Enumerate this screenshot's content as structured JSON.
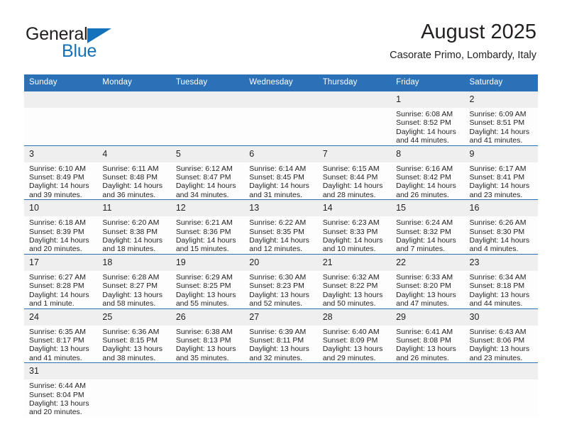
{
  "brand": {
    "name_part1": "General",
    "name_part2": "Blue",
    "triangle_icon": "triangle-icon",
    "accent_color": "#1471bb"
  },
  "header": {
    "title": "August 2025",
    "subtitle": "Casorate Primo, Lombardy, Italy"
  },
  "colors": {
    "header_blue": "#2b71b8",
    "daynum_band": "#efefef",
    "row_divider": "#2b71b8",
    "text": "#231f20"
  },
  "calendar": {
    "weekday_headers": [
      "Sunday",
      "Monday",
      "Tuesday",
      "Wednesday",
      "Thursday",
      "Friday",
      "Saturday"
    ],
    "weeks": [
      [
        {
          "day": "",
          "info": ""
        },
        {
          "day": "",
          "info": ""
        },
        {
          "day": "",
          "info": ""
        },
        {
          "day": "",
          "info": ""
        },
        {
          "day": "",
          "info": ""
        },
        {
          "day": "1",
          "info": "Sunrise: 6:08 AM\nSunset: 8:52 PM\nDaylight: 14 hours\nand 44 minutes."
        },
        {
          "day": "2",
          "info": "Sunrise: 6:09 AM\nSunset: 8:51 PM\nDaylight: 14 hours\nand 41 minutes."
        }
      ],
      [
        {
          "day": "3",
          "info": "Sunrise: 6:10 AM\nSunset: 8:49 PM\nDaylight: 14 hours\nand 39 minutes."
        },
        {
          "day": "4",
          "info": "Sunrise: 6:11 AM\nSunset: 8:48 PM\nDaylight: 14 hours\nand 36 minutes."
        },
        {
          "day": "5",
          "info": "Sunrise: 6:12 AM\nSunset: 8:47 PM\nDaylight: 14 hours\nand 34 minutes."
        },
        {
          "day": "6",
          "info": "Sunrise: 6:14 AM\nSunset: 8:45 PM\nDaylight: 14 hours\nand 31 minutes."
        },
        {
          "day": "7",
          "info": "Sunrise: 6:15 AM\nSunset: 8:44 PM\nDaylight: 14 hours\nand 28 minutes."
        },
        {
          "day": "8",
          "info": "Sunrise: 6:16 AM\nSunset: 8:42 PM\nDaylight: 14 hours\nand 26 minutes."
        },
        {
          "day": "9",
          "info": "Sunrise: 6:17 AM\nSunset: 8:41 PM\nDaylight: 14 hours\nand 23 minutes."
        }
      ],
      [
        {
          "day": "10",
          "info": "Sunrise: 6:18 AM\nSunset: 8:39 PM\nDaylight: 14 hours\nand 20 minutes."
        },
        {
          "day": "11",
          "info": "Sunrise: 6:20 AM\nSunset: 8:38 PM\nDaylight: 14 hours\nand 18 minutes."
        },
        {
          "day": "12",
          "info": "Sunrise: 6:21 AM\nSunset: 8:36 PM\nDaylight: 14 hours\nand 15 minutes."
        },
        {
          "day": "13",
          "info": "Sunrise: 6:22 AM\nSunset: 8:35 PM\nDaylight: 14 hours\nand 12 minutes."
        },
        {
          "day": "14",
          "info": "Sunrise: 6:23 AM\nSunset: 8:33 PM\nDaylight: 14 hours\nand 10 minutes."
        },
        {
          "day": "15",
          "info": "Sunrise: 6:24 AM\nSunset: 8:32 PM\nDaylight: 14 hours\nand 7 minutes."
        },
        {
          "day": "16",
          "info": "Sunrise: 6:26 AM\nSunset: 8:30 PM\nDaylight: 14 hours\nand 4 minutes."
        }
      ],
      [
        {
          "day": "17",
          "info": "Sunrise: 6:27 AM\nSunset: 8:28 PM\nDaylight: 14 hours\nand 1 minute."
        },
        {
          "day": "18",
          "info": "Sunrise: 6:28 AM\nSunset: 8:27 PM\nDaylight: 13 hours\nand 58 minutes."
        },
        {
          "day": "19",
          "info": "Sunrise: 6:29 AM\nSunset: 8:25 PM\nDaylight: 13 hours\nand 55 minutes."
        },
        {
          "day": "20",
          "info": "Sunrise: 6:30 AM\nSunset: 8:23 PM\nDaylight: 13 hours\nand 52 minutes."
        },
        {
          "day": "21",
          "info": "Sunrise: 6:32 AM\nSunset: 8:22 PM\nDaylight: 13 hours\nand 50 minutes."
        },
        {
          "day": "22",
          "info": "Sunrise: 6:33 AM\nSunset: 8:20 PM\nDaylight: 13 hours\nand 47 minutes."
        },
        {
          "day": "23",
          "info": "Sunrise: 6:34 AM\nSunset: 8:18 PM\nDaylight: 13 hours\nand 44 minutes."
        }
      ],
      [
        {
          "day": "24",
          "info": "Sunrise: 6:35 AM\nSunset: 8:17 PM\nDaylight: 13 hours\nand 41 minutes."
        },
        {
          "day": "25",
          "info": "Sunrise: 6:36 AM\nSunset: 8:15 PM\nDaylight: 13 hours\nand 38 minutes."
        },
        {
          "day": "26",
          "info": "Sunrise: 6:38 AM\nSunset: 8:13 PM\nDaylight: 13 hours\nand 35 minutes."
        },
        {
          "day": "27",
          "info": "Sunrise: 6:39 AM\nSunset: 8:11 PM\nDaylight: 13 hours\nand 32 minutes."
        },
        {
          "day": "28",
          "info": "Sunrise: 6:40 AM\nSunset: 8:09 PM\nDaylight: 13 hours\nand 29 minutes."
        },
        {
          "day": "29",
          "info": "Sunrise: 6:41 AM\nSunset: 8:08 PM\nDaylight: 13 hours\nand 26 minutes."
        },
        {
          "day": "30",
          "info": "Sunrise: 6:43 AM\nSunset: 8:06 PM\nDaylight: 13 hours\nand 23 minutes."
        }
      ],
      [
        {
          "day": "31",
          "info": "Sunrise: 6:44 AM\nSunset: 8:04 PM\nDaylight: 13 hours\nand 20 minutes."
        },
        {
          "day": "",
          "info": ""
        },
        {
          "day": "",
          "info": ""
        },
        {
          "day": "",
          "info": ""
        },
        {
          "day": "",
          "info": ""
        },
        {
          "day": "",
          "info": ""
        },
        {
          "day": "",
          "info": ""
        }
      ]
    ]
  }
}
